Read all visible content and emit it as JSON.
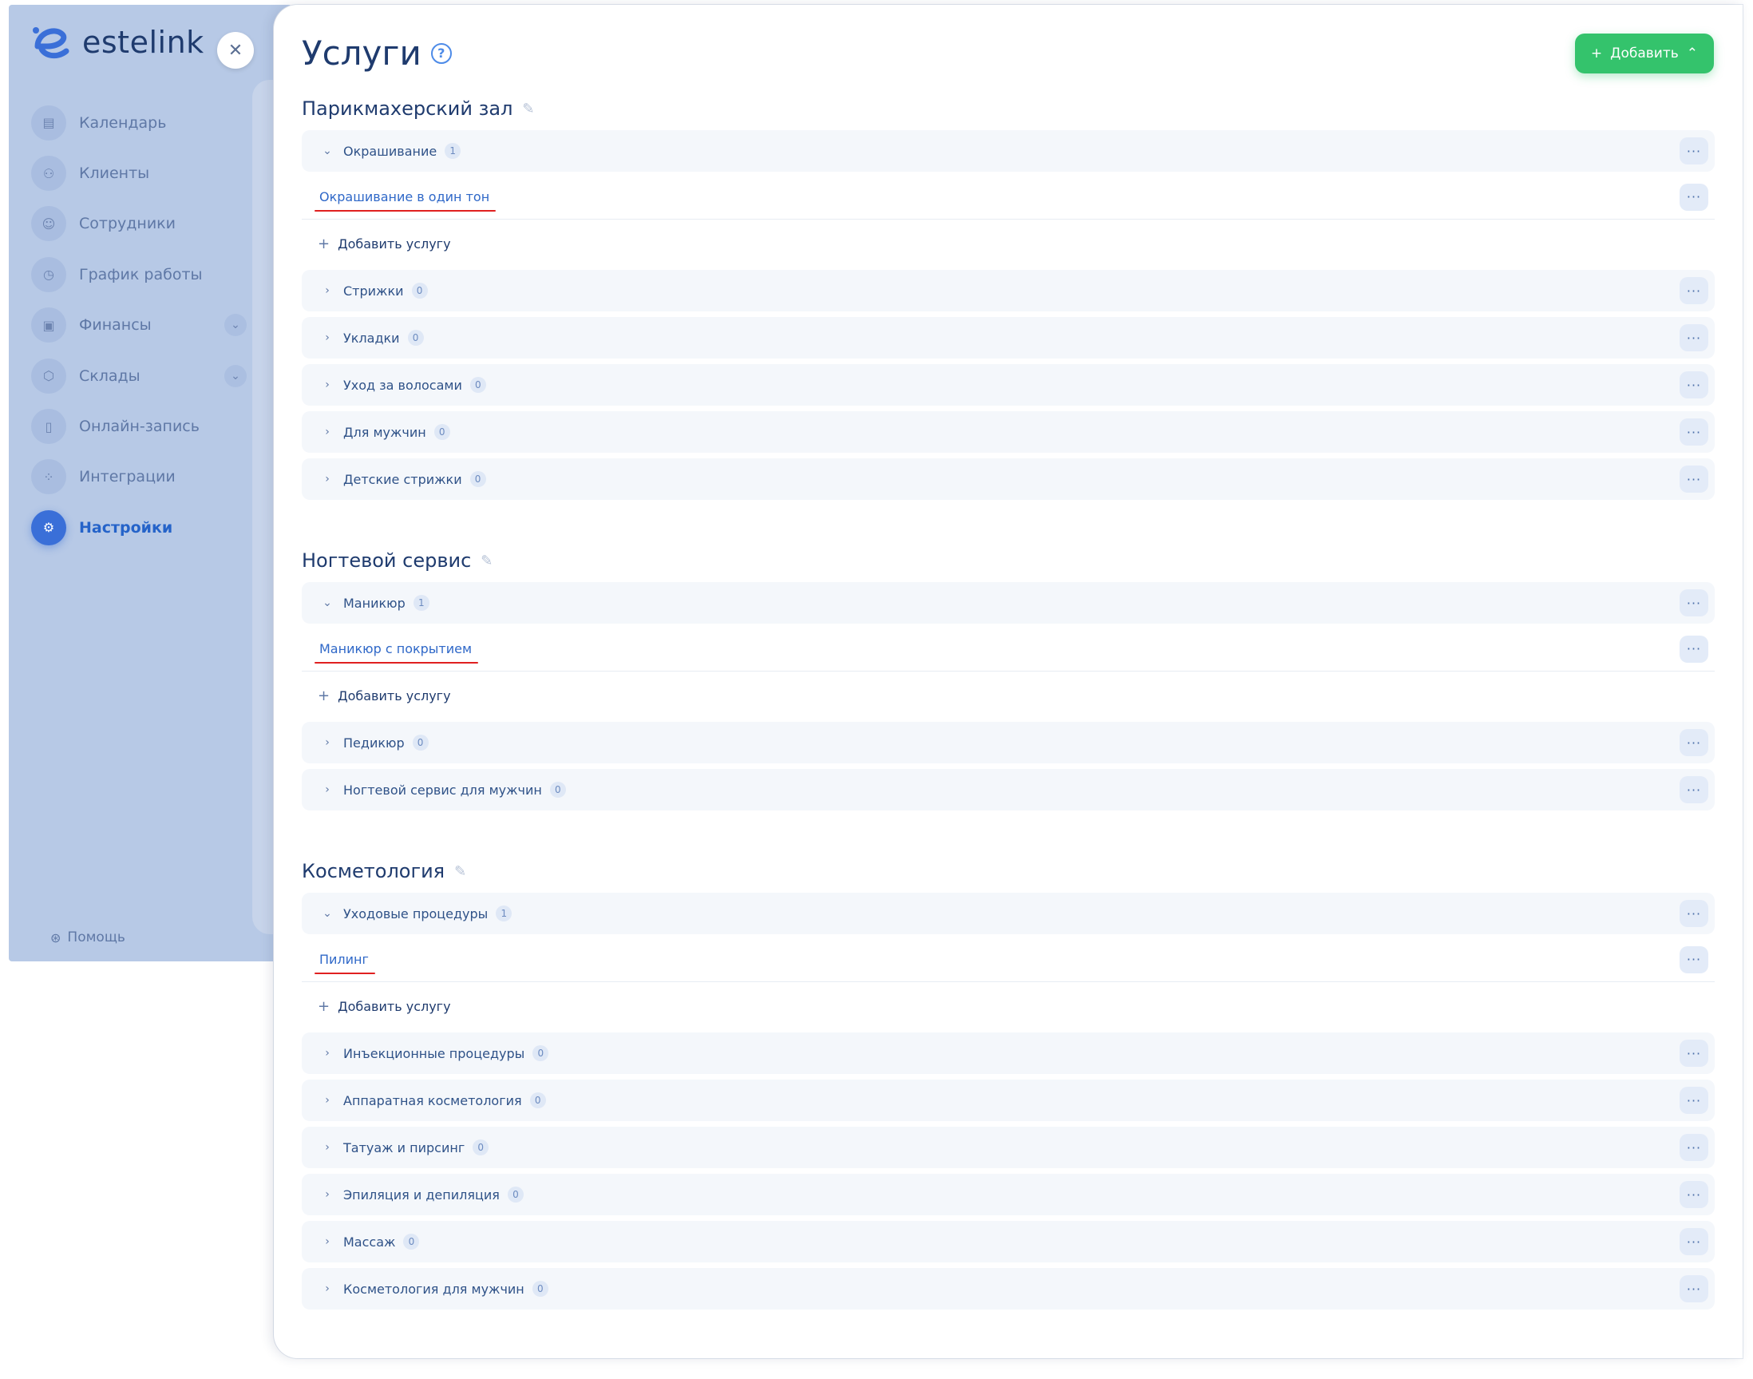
{
  "brand": {
    "name": "estelink"
  },
  "sidebar": {
    "items": [
      {
        "label": "Календарь",
        "icon": "calendar-icon"
      },
      {
        "label": "Клиенты",
        "icon": "clients-icon"
      },
      {
        "label": "Сотрудники",
        "icon": "employee-icon"
      },
      {
        "label": "График работы",
        "icon": "clock-icon"
      },
      {
        "label": "Финансы",
        "icon": "wallet-icon",
        "expandable": true
      },
      {
        "label": "Склады",
        "icon": "warehouse-icon",
        "expandable": true
      },
      {
        "label": "Онлайн-запись",
        "icon": "online-booking-icon"
      },
      {
        "label": "Интеграции",
        "icon": "integrations-icon"
      },
      {
        "label": "Настройки",
        "icon": "gear-icon",
        "active": true
      }
    ],
    "help_label": "Помощь"
  },
  "header": {
    "title": "Услуги",
    "add_label": "Добавить"
  },
  "sections": [
    {
      "title": "Парикмахерский зал",
      "categories": [
        {
          "label": "Окрашивание",
          "count": "1",
          "expanded": true,
          "services": [
            "Окрашивание в один тон"
          ],
          "add_service_label": "Добавить услугу"
        },
        {
          "label": "Стрижки",
          "count": "0"
        },
        {
          "label": "Укладки",
          "count": "0"
        },
        {
          "label": "Уход за волосами",
          "count": "0"
        },
        {
          "label": "Для мужчин",
          "count": "0"
        },
        {
          "label": "Детские стрижки",
          "count": "0"
        }
      ]
    },
    {
      "title": "Ногтевой сервис",
      "categories": [
        {
          "label": "Маникюр",
          "count": "1",
          "expanded": true,
          "services": [
            "Маникюр с покрытием"
          ],
          "add_service_label": "Добавить услугу"
        },
        {
          "label": "Педикюр",
          "count": "0"
        },
        {
          "label": "Ногтевой сервис для мужчин",
          "count": "0"
        }
      ]
    },
    {
      "title": "Косметология",
      "categories": [
        {
          "label": "Уходовые процедуры",
          "count": "1",
          "expanded": true,
          "services": [
            "Пилинг"
          ],
          "add_service_label": "Добавить услугу"
        },
        {
          "label": "Инъекционные процедуры",
          "count": "0"
        },
        {
          "label": "Аппаратная косметология",
          "count": "0"
        },
        {
          "label": "Татуаж и пирсинг",
          "count": "0"
        },
        {
          "label": "Эпиляция и депиляция",
          "count": "0"
        },
        {
          "label": "Массаж",
          "count": "0"
        },
        {
          "label": "Косметология для мужчин",
          "count": "0"
        }
      ]
    }
  ],
  "colors": {
    "accent": "#3a6fd8",
    "add_button": "#34c36c",
    "highlight_underline": "#e02020"
  }
}
